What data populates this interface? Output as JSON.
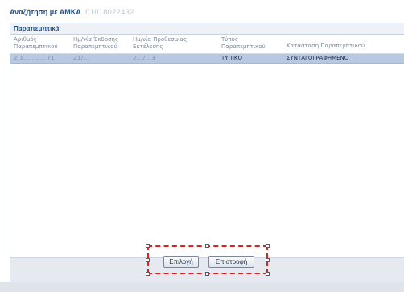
{
  "search": {
    "label": "Αναζήτηση με ΑΜΚΑ",
    "amka_value": "01018022432"
  },
  "panel": {
    "title": "Παραπεμπτικά"
  },
  "table": {
    "columns": [
      "Αριθμός Παραπεμπτικού",
      "Ημ/νία Έκδοσης Παραπεμπτικού",
      "Ημ/νία Προθεσμίας Εκτέλεσης",
      "Τύπος Παραπεμπτικού",
      "Κατάσταση Παραπεμπτικού"
    ],
    "rows": [
      {
        "number": "2 1...........71",
        "issue_date": "21/...",
        "deadline": "2.../...3",
        "type": "ΤΥΠΙΚΟ",
        "status": "ΣΥΝΤΑΓΟΓΡΑΦΗΜΕΝΟ"
      }
    ]
  },
  "actions": {
    "select_label": "Επιλογή",
    "back_label": "Επιστροφή"
  },
  "colors": {
    "title_blue": "#1f4e8c",
    "selected_row": "#b7c8e0",
    "highlight_red": "#e01f1f"
  }
}
